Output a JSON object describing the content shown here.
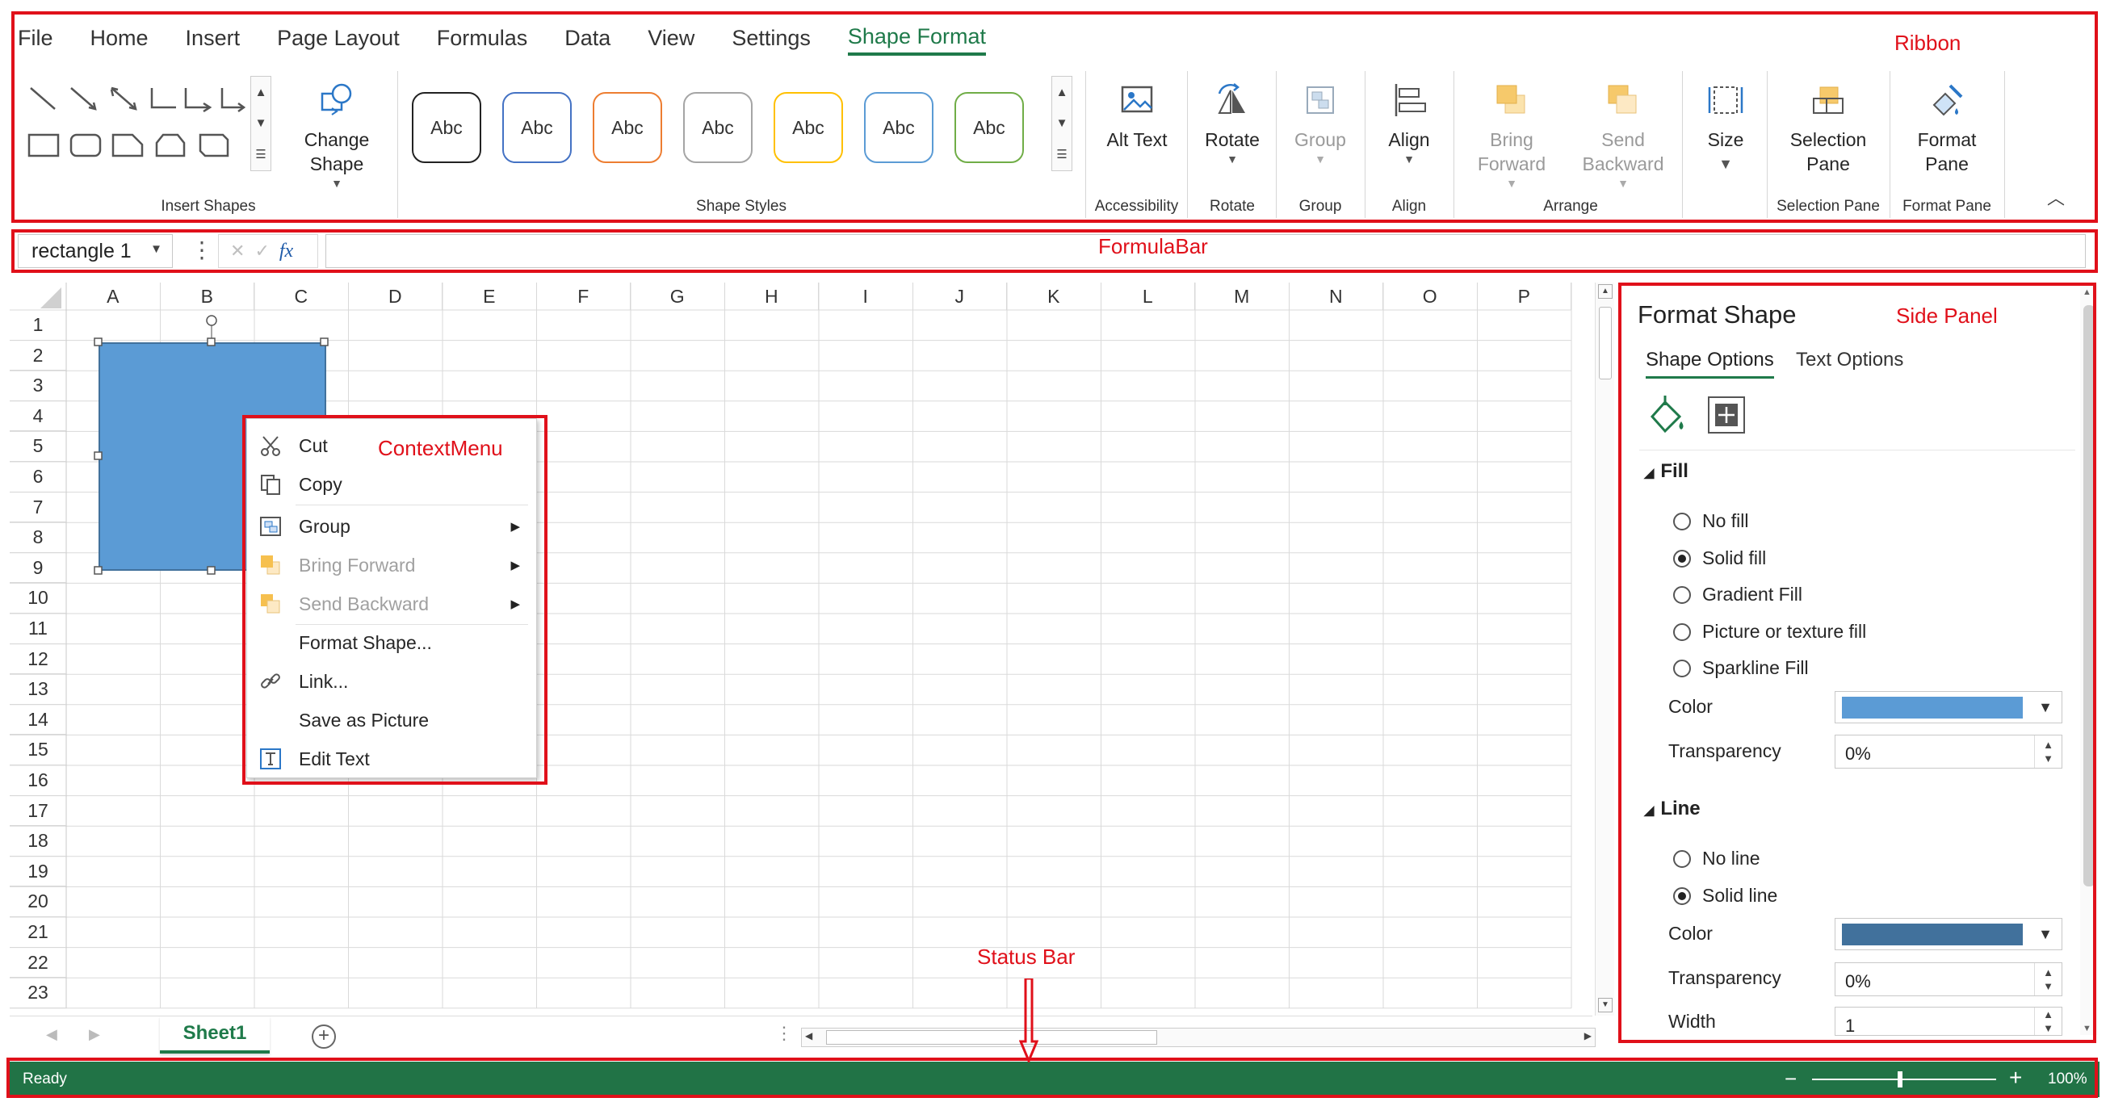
{
  "menu_tabs": [
    "File",
    "Home",
    "Insert",
    "Page Layout",
    "Formulas",
    "Data",
    "View",
    "Settings",
    "Shape Format"
  ],
  "active_tab": "Shape Format",
  "ribbon": {
    "groups": {
      "insert_shapes": "Insert Shapes",
      "shape_styles": "Shape Styles",
      "accessibility": "Accessibility",
      "rotate": "Rotate",
      "group": "Group",
      "align": "Align",
      "arrange": "Arrange",
      "selection_pane": "Selection Pane",
      "format_pane": "Format Pane"
    },
    "change_shape": [
      "Change",
      "Shape"
    ],
    "style_label": "Abc",
    "style_colors": [
      "#222222",
      "#4472c4",
      "#ed7d31",
      "#a5a5a5",
      "#ffc000",
      "#5b9bd5",
      "#70ad47"
    ],
    "alt_text": "Alt Text",
    "rotate": "Rotate",
    "group": "Group",
    "align": "Align",
    "bring_forward": [
      "Bring",
      "Forward"
    ],
    "send_backward": [
      "Send",
      "Backward"
    ],
    "size": "Size",
    "selection_pane": [
      "Selection",
      "Pane"
    ],
    "format_pane": [
      "Format",
      "Pane"
    ]
  },
  "formula_bar": {
    "name_box": "rectangle 1",
    "fx": "fx",
    "value": ""
  },
  "grid": {
    "columns": [
      "A",
      "B",
      "C",
      "D",
      "E",
      "F",
      "G",
      "H",
      "I",
      "J",
      "K",
      "L",
      "M",
      "N",
      "O",
      "P"
    ],
    "rows": [
      "1",
      "2",
      "3",
      "4",
      "5",
      "6",
      "7",
      "8",
      "9",
      "10",
      "11",
      "12",
      "13",
      "14",
      "15",
      "16",
      "17",
      "18",
      "19",
      "20",
      "21",
      "22",
      "23"
    ]
  },
  "context_menu": {
    "items": [
      {
        "label": "Cut",
        "icon": "scissors-icon",
        "disabled": false,
        "submenu": false
      },
      {
        "label": "Copy",
        "icon": "copy-icon",
        "disabled": false,
        "submenu": false
      },
      {
        "label": "Group",
        "icon": "group-icon",
        "disabled": false,
        "submenu": true
      },
      {
        "label": "Bring Forward",
        "icon": "bring-forward-icon",
        "disabled": true,
        "submenu": true
      },
      {
        "label": "Send Backward",
        "icon": "send-backward-icon",
        "disabled": true,
        "submenu": true
      },
      {
        "label": "Format Shape...",
        "icon": "",
        "disabled": false,
        "submenu": false
      },
      {
        "label": "Link...",
        "icon": "link-icon",
        "disabled": false,
        "submenu": false
      },
      {
        "label": "Save as Picture",
        "icon": "",
        "disabled": false,
        "submenu": false
      },
      {
        "label": "Edit Text",
        "icon": "edit-text-icon",
        "disabled": false,
        "submenu": false
      }
    ]
  },
  "side_panel": {
    "title": "Format Shape",
    "tabs": [
      "Shape Options",
      "Text Options"
    ],
    "fill": {
      "heading": "Fill",
      "options": [
        "No fill",
        "Solid fill",
        "Gradient Fill",
        "Picture or texture fill",
        "Sparkline Fill"
      ],
      "selected": "Solid fill",
      "color_label": "Color",
      "color": "#5b9bd5",
      "transparency_label": "Transparency",
      "transparency": "0%"
    },
    "line": {
      "heading": "Line",
      "options": [
        "No line",
        "Solid line"
      ],
      "selected": "Solid line",
      "color_label": "Color",
      "color": "#41719c",
      "transparency_label": "Transparency",
      "transparency": "0%",
      "width_label": "Width",
      "width": "1"
    }
  },
  "sheet_tabs": {
    "active": "Sheet1"
  },
  "status_bar": {
    "status": "Ready",
    "zoom": "100%"
  },
  "shape_fill": "#5b9bd5",
  "annotations": {
    "ribbon": "Ribbon",
    "formula_bar": "FormulaBar",
    "context_menu": "ContextMenu",
    "side_panel": "Side Panel",
    "status_bar": "Status Bar"
  }
}
